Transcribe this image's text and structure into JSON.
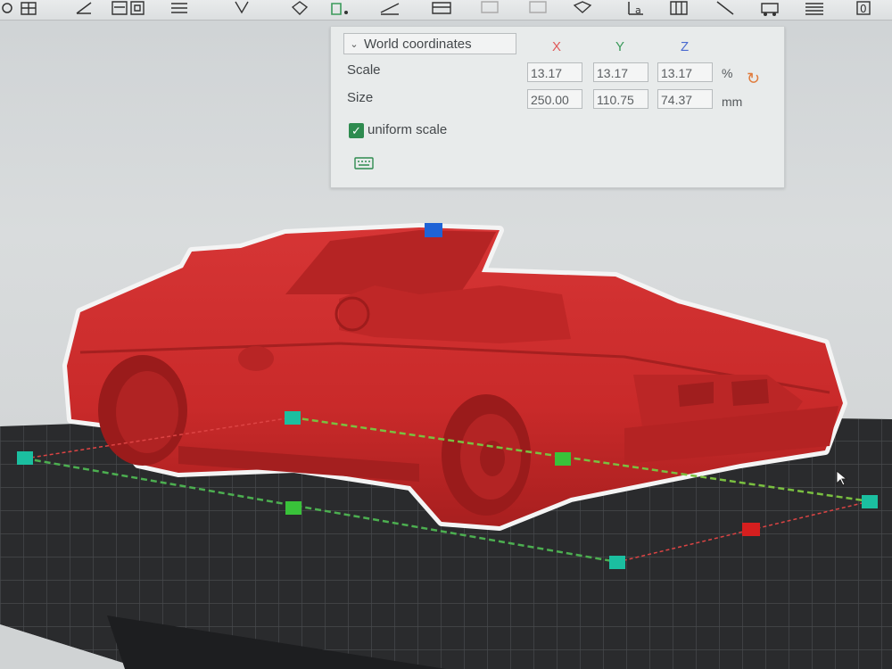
{
  "toolbar": {
    "icons": [
      "move-icon",
      "grid-icon",
      "edit-icon",
      "scale-icon",
      "layers-icon",
      "align-icon",
      "rotate-icon",
      "place-icon",
      "cut-icon",
      "support-icon",
      "paint-icon",
      "seam-icon",
      "text-icon",
      "split-icon",
      "measure-icon",
      "assemble-icon",
      "arrange-icon",
      "sla-icon",
      "zero-icon"
    ]
  },
  "panel": {
    "coordinate_system": "World coordinates",
    "axes": {
      "x": "X",
      "y": "Y",
      "z": "Z"
    },
    "axis_colors": {
      "x": "#e05a5a",
      "y": "#3a9a5a",
      "z": "#4a6ad0"
    },
    "scale": {
      "label": "Scale",
      "x": "13.17",
      "y": "13.17",
      "z": "13.17",
      "unit": "%"
    },
    "size": {
      "label": "Size",
      "x": "250.00",
      "y": "110.75",
      "z": "74.37",
      "unit": "mm"
    },
    "uniform_scale": {
      "label": "uniform scale",
      "checked": true
    }
  },
  "colors": {
    "model": "#d42c2c",
    "bed": "#2a2b2d",
    "grid_line": "#444649"
  }
}
